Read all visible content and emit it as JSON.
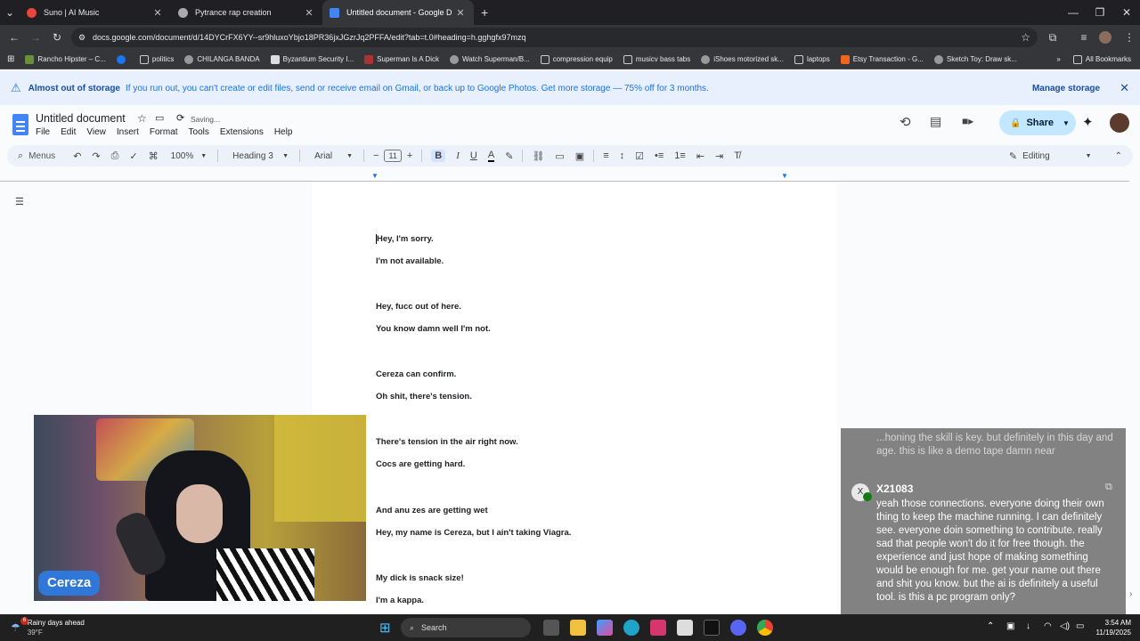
{
  "browser": {
    "tabs": [
      {
        "title": "Suno | AI Music",
        "color": "#e8453c"
      },
      {
        "title": "Pytrance rap creation",
        "color": "#aaaaaa"
      },
      {
        "title": "Untitled document - Google D",
        "color": "#4285f4"
      }
    ],
    "new_tab": "+",
    "url": "docs.google.com/document/d/14DYCrFX6YY--sr9hluxoYbjo18PR36jxJGzrJq2PFFA/edit?tab=t.0#heading=h.gghgfx97mzq",
    "bookmarks": [
      "Rancho Hipster – C...",
      "politics",
      "CHILANGA BANDA",
      "Byzantium Security I...",
      "Superman Is A Dick",
      "Watch Superman/B...",
      "compression equip",
      "musicv bass tabs",
      "iShoes motorized sk...",
      "laptops",
      "Etsy Transaction - G...",
      "Sketch Toy: Draw sk..."
    ],
    "all_bookmarks": "All Bookmarks"
  },
  "banner": {
    "title": "Almost out of storage",
    "message": "If you run out, you can't create or edit files, send or receive email on Gmail, or back up to Google Photos. Get more storage — 75% off for 3 months.",
    "action": "Manage storage"
  },
  "doc": {
    "title": "Untitled document",
    "status": "Saving...",
    "menu": [
      "File",
      "Edit",
      "View",
      "Insert",
      "Format",
      "Tools",
      "Extensions",
      "Help"
    ],
    "share": "Share"
  },
  "toolbar": {
    "menus": "Menus",
    "zoom": "100%",
    "style": "Heading 3",
    "font": "Arial",
    "size": "11",
    "mode": "Editing"
  },
  "lines": [
    "Hey, I'm sorry.",
    "I'm not available.",
    "Hey, fucc out of here.",
    "You know damn well I'm not.",
    "Cereza can confirm.",
    "Oh shit, there's tension.",
    "There's tension in the air right now.",
    "Cocs are getting hard.",
    "And anu zes are getting wet",
    "Hey, my name is Cereza, but I ain't taking Viagra.",
    "My dick is snack size!",
    " I'm a kappa."
  ],
  "video": {
    "name": "Cereza"
  },
  "chat": {
    "faded_text": "...honing the skill is key. but definitely in this day and age. this is like a demo tape damn near",
    "avatar_letter": "X",
    "username": "X21083",
    "message": "yeah those connections. everyone doing their own thing to keep the machine running. I can definitely see. everyone doin something to contribute. really sad that people won't do it for free though. the experience and just hope of making something would be enough for me. get your name out there and shit you know. but the ai is definitely a useful tool. is this a pc program only?"
  },
  "taskbar": {
    "weather_title": "Rainy days ahead",
    "weather_temp": "39°F",
    "weather_badge": "6",
    "search": "Search",
    "time": "3:54 AM",
    "date": "11/19/2025"
  }
}
